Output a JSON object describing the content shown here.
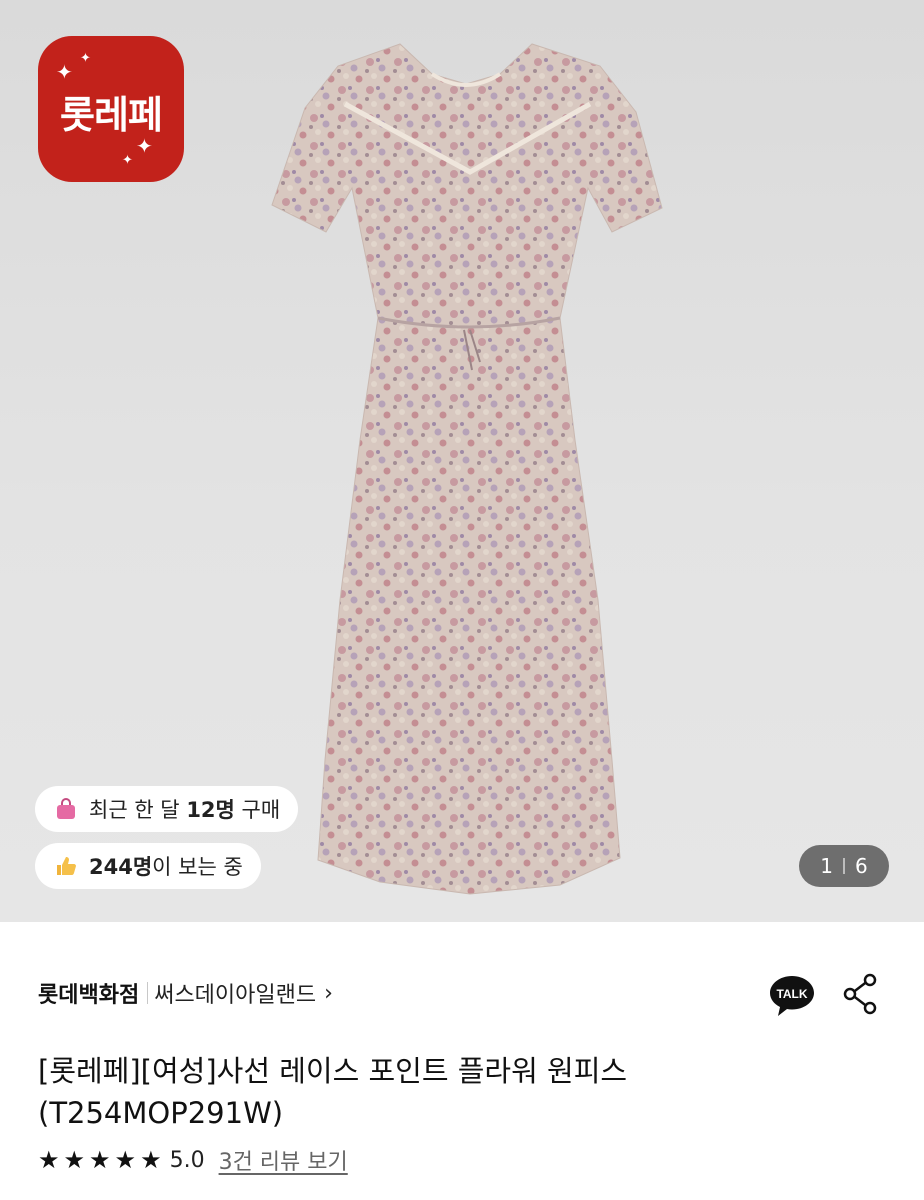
{
  "logo": {
    "text": "롯레페",
    "color": "#c2221b",
    "icon": "sparkle-icon"
  },
  "badges": {
    "recent_purchase": {
      "prefix": "최근 한 달 ",
      "count": "12명",
      "suffix": " 구매",
      "icon": "shopping-bag-icon"
    },
    "viewers": {
      "count": "244명",
      "suffix": "이 보는 중",
      "icon": "thumbs-up-icon"
    }
  },
  "gallery": {
    "current": "1",
    "total": "6"
  },
  "store": {
    "name": "롯데백화점",
    "brand": "써스데이아일랜드"
  },
  "actions": {
    "talk_label": "TALK",
    "share_icon": "share-icon"
  },
  "product": {
    "title": "[롯레페][여성]사선 레이스 포인트 플라워 원피스 (T254MOP291W)"
  },
  "rating": {
    "stars": 5,
    "score": "5.0",
    "review_link": "3건 리뷰 보기"
  }
}
